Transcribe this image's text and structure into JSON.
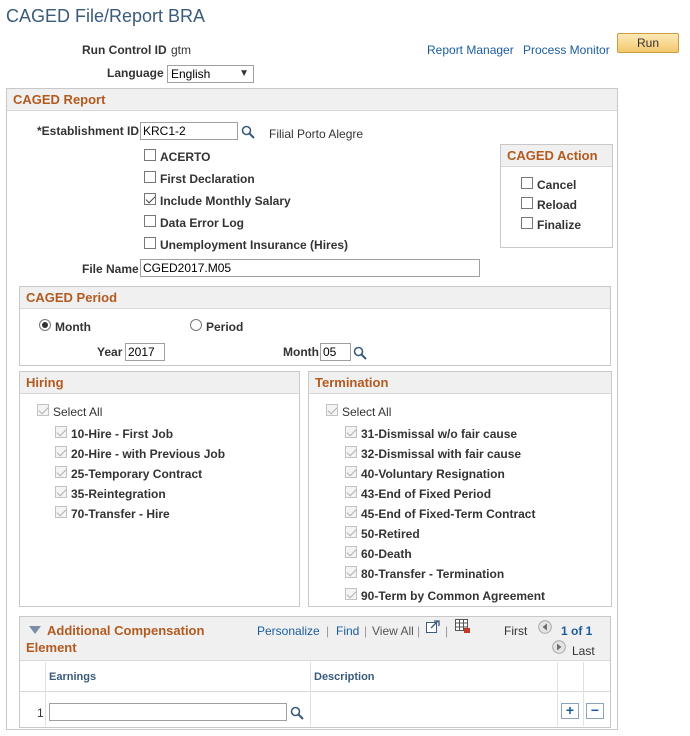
{
  "page": {
    "title": "CAGED File/Report BRA"
  },
  "header": {
    "run_control_label": "Run Control ID",
    "run_control_value": "gtm",
    "language_label": "Language",
    "language_value": "English",
    "report_manager": "Report Manager",
    "process_monitor": "Process Monitor",
    "run_button": "Run"
  },
  "caged_report": {
    "title": "CAGED Report",
    "establishment_label": "*Establishment ID",
    "establishment_value": "KRC1-2",
    "establishment_desc": "Filial Porto Alegre",
    "options": [
      {
        "label": "ACERTO",
        "checked": false
      },
      {
        "label": "First Declaration",
        "checked": false
      },
      {
        "label": "Include Monthly Salary",
        "checked": true
      },
      {
        "label": "Data Error Log",
        "checked": false
      },
      {
        "label": "Unemployment Insurance (Hires)",
        "checked": false
      }
    ],
    "file_name_label": "File Name",
    "file_name_value": "CGED2017.M05",
    "action": {
      "title": "CAGED Action",
      "items": [
        {
          "label": "Cancel",
          "checked": false
        },
        {
          "label": "Reload",
          "checked": false
        },
        {
          "label": "Finalize",
          "checked": false
        }
      ]
    }
  },
  "caged_period": {
    "title": "CAGED Period",
    "month_radio": "Month",
    "period_radio": "Period",
    "year_label": "Year",
    "year_value": "2017",
    "month_label": "Month",
    "month_value": "05"
  },
  "hiring": {
    "title": "Hiring",
    "select_all": "Select All",
    "items": [
      "10-Hire - First Job",
      "20-Hire - with Previous Job",
      "25-Temporary Contract",
      "35-Reintegration",
      "70-Transfer - Hire"
    ]
  },
  "termination": {
    "title": "Termination",
    "select_all": "Select All",
    "items": [
      "31-Dismissal w/o fair cause",
      "32-Dismissal with fair cause",
      "40-Voluntary Resignation",
      "43-End of Fixed Period",
      "45-End of Fixed-Term Contract",
      "50-Retired",
      "60-Death",
      "80-Transfer - Termination",
      "90-Term by Common Agreement"
    ]
  },
  "addl_comp": {
    "title_line1": "Additional Compensation",
    "title_line2": "Element",
    "personalize": "Personalize",
    "find": "Find",
    "view_all": "View All",
    "first": "First",
    "page_info": "1 of 1",
    "last": "Last",
    "col_earnings": "Earnings",
    "col_description": "Description",
    "row_number": "1",
    "earnings_value": ""
  }
}
